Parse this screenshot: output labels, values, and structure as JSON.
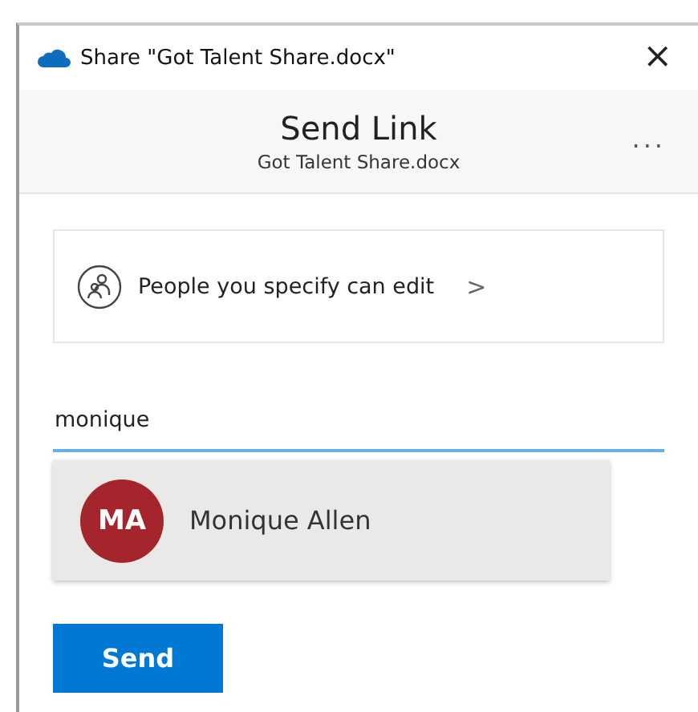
{
  "window": {
    "title": "Share \"Got Talent Share.docx\"",
    "close": "×"
  },
  "header": {
    "title": "Send Link",
    "subtitle": "Got Talent Share.docx",
    "more": "..."
  },
  "permission": {
    "label": "People you specify can edit",
    "chevron": ">"
  },
  "recipient_field": {
    "value": "monique"
  },
  "suggestions": [
    {
      "initials": "MA",
      "name": "Monique Allen",
      "color": "#a4262c"
    }
  ],
  "buttons": [
    {
      "label": "Send",
      "kind": "primary"
    }
  ]
}
